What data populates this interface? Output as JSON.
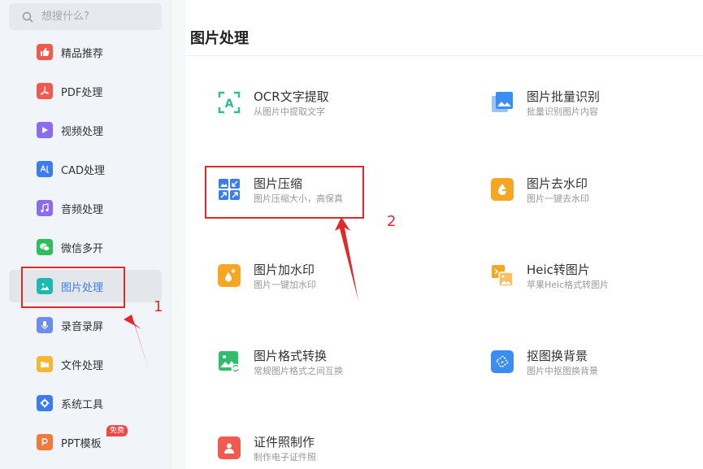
{
  "search": {
    "placeholder": "想搜什么?"
  },
  "sidebar": {
    "items": [
      {
        "label": "精品推荐",
        "icon": "thumbs-up-icon",
        "color": "#f05a4f"
      },
      {
        "label": "PDF处理",
        "icon": "pdf-icon",
        "color": "#f05a4f"
      },
      {
        "label": "视频处理",
        "icon": "play-icon",
        "color": "#8a6cf0"
      },
      {
        "label": "CAD处理",
        "icon": "cad-icon",
        "color": "#3b7df0"
      },
      {
        "label": "音频处理",
        "icon": "music-icon",
        "color": "#8a6cf0"
      },
      {
        "label": "微信多开",
        "icon": "wechat-icon",
        "color": "#2fbf5a"
      },
      {
        "label": "图片处理",
        "icon": "image-icon",
        "color": "#1fb8b0"
      },
      {
        "label": "录音录屏",
        "icon": "microphone-icon",
        "color": "#6c8cf0"
      },
      {
        "label": "文件处理",
        "icon": "folder-icon",
        "color": "#f5b830"
      },
      {
        "label": "系统工具",
        "icon": "gear-icon",
        "color": "#3b7df0"
      },
      {
        "label": "PPT模板",
        "icon": "ppt-icon",
        "color": "#f07a3a",
        "badge": "免费"
      }
    ],
    "active_label": "图片处理"
  },
  "main": {
    "title": "图片处理",
    "tools": [
      {
        "name": "OCR文字提取",
        "desc": "从图片中提取文字",
        "icon": "ocr-icon",
        "color": "#2fbf8a"
      },
      {
        "name": "图片批量识别",
        "desc": "批量识别图片内容",
        "icon": "batch-image-icon",
        "color": "#3b8ef0"
      },
      {
        "name": "图片压缩",
        "desc": "图片压缩大小，高保真",
        "icon": "compress-icon",
        "color": "#3b7df0"
      },
      {
        "name": "图片去水印",
        "desc": "图片一键去水印",
        "icon": "remove-watermark-icon",
        "color": "#f5a623"
      },
      {
        "name": "图片加水印",
        "desc": "图片一键加水印",
        "icon": "add-watermark-icon",
        "color": "#f5a623"
      },
      {
        "name": "Heic转图片",
        "desc": "苹果Heic格式转图片",
        "icon": "heic-icon",
        "color": "#f5a623"
      },
      {
        "name": "图片格式转换",
        "desc": "常规图片格式之间互换",
        "icon": "format-convert-icon",
        "color": "#2fbf6a"
      },
      {
        "name": "抠图换背景",
        "desc": "图片中抠图换背景",
        "icon": "cutout-icon",
        "color": "#3b8ef0"
      },
      {
        "name": "证件照制作",
        "desc": "制作电子证件照",
        "icon": "id-photo-icon",
        "color": "#f05a4f"
      }
    ]
  },
  "annotations": {
    "step1": "1",
    "step2": "2",
    "color": "#e02a2a"
  }
}
